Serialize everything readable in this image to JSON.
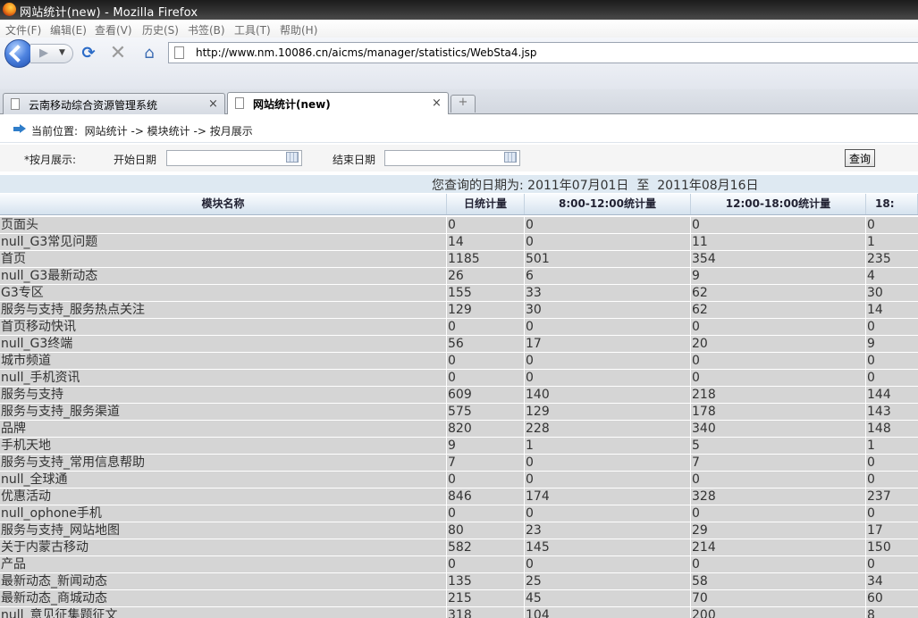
{
  "window": {
    "title": "网站统计(new) - Mozilla Firefox"
  },
  "menu": [
    "文件(F)",
    "编辑(E)",
    "查看(V)",
    "历史(S)",
    "书签(B)",
    "工具(T)",
    "帮助(H)"
  ],
  "navbar": {
    "url": "http://www.nm.10086.cn/aicms/manager/statistics/WebSta4.jsp"
  },
  "tabs": [
    {
      "label": "云南移动综合资源管理系统",
      "close": "×"
    },
    {
      "label": "网站统计(new)",
      "close": "×"
    }
  ],
  "new_tab": "+",
  "breadcrumb": "当前位置:  网站统计 -> 模块统计 -> 按月展示",
  "query": {
    "mode_label": "*按月展示:",
    "start_label": "开始日期",
    "end_label": "结束日期",
    "start_value": "",
    "end_value": "",
    "button": "查询"
  },
  "summary": "您查询的日期为: 2011年07月01日  至  2011年08月16日",
  "table": {
    "headers": [
      "模块名称",
      "日统计量",
      "8:00-12:00统计量",
      "12:00-18:00统计量",
      "18:"
    ],
    "rows": [
      [
        "页面头",
        "0",
        "0",
        "0",
        "0"
      ],
      [
        "null_G3常见问题",
        "14",
        "0",
        "11",
        "1"
      ],
      [
        "首页",
        "1185",
        "501",
        "354",
        "235"
      ],
      [
        "null_G3最新动态",
        "26",
        "6",
        "9",
        "4"
      ],
      [
        "G3专区",
        "155",
        "33",
        "62",
        "30"
      ],
      [
        "服务与支持_服务热点关注",
        "129",
        "30",
        "62",
        "14"
      ],
      [
        "首页移动快讯",
        "0",
        "0",
        "0",
        "0"
      ],
      [
        "null_G3终端",
        "56",
        "17",
        "20",
        "9"
      ],
      [
        "城市频道",
        "0",
        "0",
        "0",
        "0"
      ],
      [
        "null_手机资讯",
        "0",
        "0",
        "0",
        "0"
      ],
      [
        "服务与支持",
        "609",
        "140",
        "218",
        "144"
      ],
      [
        "服务与支持_服务渠道",
        "575",
        "129",
        "178",
        "143"
      ],
      [
        "品牌",
        "820",
        "228",
        "340",
        "148"
      ],
      [
        "手机天地",
        "9",
        "1",
        "5",
        "1"
      ],
      [
        "服务与支持_常用信息帮助",
        "7",
        "0",
        "7",
        "0"
      ],
      [
        "null_全球通",
        "0",
        "0",
        "0",
        "0"
      ],
      [
        "优惠活动",
        "846",
        "174",
        "328",
        "237"
      ],
      [
        "null_ophone手机",
        "0",
        "0",
        "0",
        "0"
      ],
      [
        "服务与支持_网站地图",
        "80",
        "23",
        "29",
        "17"
      ],
      [
        "关于内蒙古移动",
        "582",
        "145",
        "214",
        "150"
      ],
      [
        "产品",
        "0",
        "0",
        "0",
        "0"
      ],
      [
        "最新动态_新闻动态",
        "135",
        "25",
        "58",
        "34"
      ],
      [
        "最新动态_商城动态",
        "215",
        "45",
        "70",
        "60"
      ],
      [
        "null_意见征集题征文",
        "318",
        "104",
        "200",
        "8"
      ]
    ]
  }
}
